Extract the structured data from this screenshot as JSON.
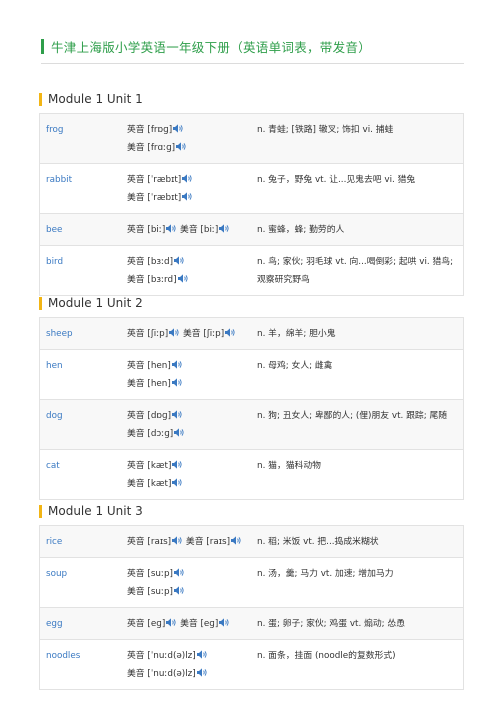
{
  "title": "牛津上海版小学英语一年级下册（英语单词表，带发音）",
  "sections": [
    {
      "heading": "Module 1 Unit 1",
      "rows": [
        {
          "word": "frog",
          "uk": "英音 [frɒɡ]",
          "us": "美音 [frɑːɡ]",
          "meaning": "n. 青蛙; [铁路] 辙叉; 饰扣 vi. 捕蛙"
        },
        {
          "word": "rabbit",
          "uk": "英音 [ˈræbɪt]",
          "us": "美音 [ˈræbɪt]",
          "meaning": "n. 兔子，野兔 vt. 让...见鬼去吧 vi. 猎兔"
        },
        {
          "word": "bee",
          "uk": "英音 [biː]",
          "us": "美音 [biː]",
          "meaning": "n. 蜜蜂，蜂; 勤劳的人"
        },
        {
          "word": "bird",
          "uk": "英音 [bɜːd]",
          "us": "美音 [bɜːrd]",
          "meaning": "n. 鸟; 家伙; 羽毛球 vt. 向...喝倒彩; 起哄 vi. 猎鸟; 观察研究野鸟"
        }
      ]
    },
    {
      "heading": "Module 1 Unit 2",
      "rows": [
        {
          "word": "sheep",
          "uk": "英音 [ʃiːp]",
          "us": "美音 [ʃiːp]",
          "meaning": "n. 羊，绵羊; 胆小鬼"
        },
        {
          "word": "hen",
          "uk": "英音 [hen]",
          "us": "美音 [hen]",
          "meaning": "n. 母鸡; 女人; 雌禽"
        },
        {
          "word": "dog",
          "uk": "英音 [dɒɡ]",
          "us": "美音 [dɔːɡ]",
          "meaning": "n. 狗; 丑女人; 卑鄙的人; (俚)朋友 vt. 跟踪; 尾随"
        },
        {
          "word": "cat",
          "uk": "英音 [kæt]",
          "us": "美音 [kæt]",
          "meaning": "n. 猫，猫科动物"
        }
      ]
    },
    {
      "heading": "Module 1 Unit 3",
      "rows": [
        {
          "word": "rice",
          "uk": "英音 [raɪs]",
          "us": "美音 [raɪs]",
          "meaning": "n. 稻; 米饭 vt. 把...捣成米糊状"
        },
        {
          "word": "soup",
          "uk": "英音 [suːp]",
          "us": "美音 [suːp]",
          "meaning": "n. 汤，羹; 马力 vt. 加速; 增加马力"
        },
        {
          "word": "egg",
          "uk": "英音 [eɡ]",
          "us": "美音 [eɡ]",
          "meaning": "n. 蛋; 卵子; 家伙; 鸡蛋 vt. 煽动; 怂恿"
        },
        {
          "word": "noodles",
          "uk": "英音 [ˈnuːd(ə)lz]",
          "us": "美音 [ˈnuːd(ə)lz]",
          "meaning": "n. 面条，挂面 (noodle的复数形式)"
        }
      ]
    }
  ],
  "layout_flags": {
    "inline_pron": [
      [
        2
      ],
      [
        0
      ],
      [
        0,
        2
      ]
    ]
  },
  "icons": {
    "pronounce": "speaker-icon"
  },
  "colors": {
    "title": "#2e9e4a",
    "section_bar": "#f2b515",
    "word": "#3a79c2",
    "icon": "#3a79c2"
  }
}
